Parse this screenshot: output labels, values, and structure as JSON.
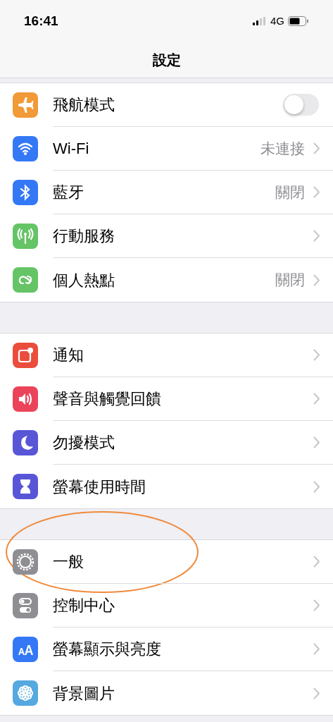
{
  "status_bar": {
    "time": "16:41",
    "network": "4G"
  },
  "title": "設定",
  "groups": [
    {
      "items": [
        {
          "label": "飛航模式",
          "kind": "toggle",
          "on": false
        },
        {
          "label": "Wi-Fi",
          "kind": "link",
          "value": "未連接"
        },
        {
          "label": "藍牙",
          "kind": "link",
          "value": "關閉"
        },
        {
          "label": "行動服務",
          "kind": "link"
        },
        {
          "label": "個人熱點",
          "kind": "link",
          "value": "關閉"
        }
      ]
    },
    {
      "items": [
        {
          "label": "通知",
          "kind": "link"
        },
        {
          "label": "聲音與觸覺回饋",
          "kind": "link"
        },
        {
          "label": "勿擾模式",
          "kind": "link"
        },
        {
          "label": "螢幕使用時間",
          "kind": "link"
        }
      ]
    },
    {
      "items": [
        {
          "label": "一般",
          "kind": "link",
          "circled": true
        },
        {
          "label": "控制中心",
          "kind": "link"
        },
        {
          "label": "螢幕顯示與亮度",
          "kind": "link"
        },
        {
          "label": "背景圖片",
          "kind": "link"
        }
      ]
    }
  ]
}
